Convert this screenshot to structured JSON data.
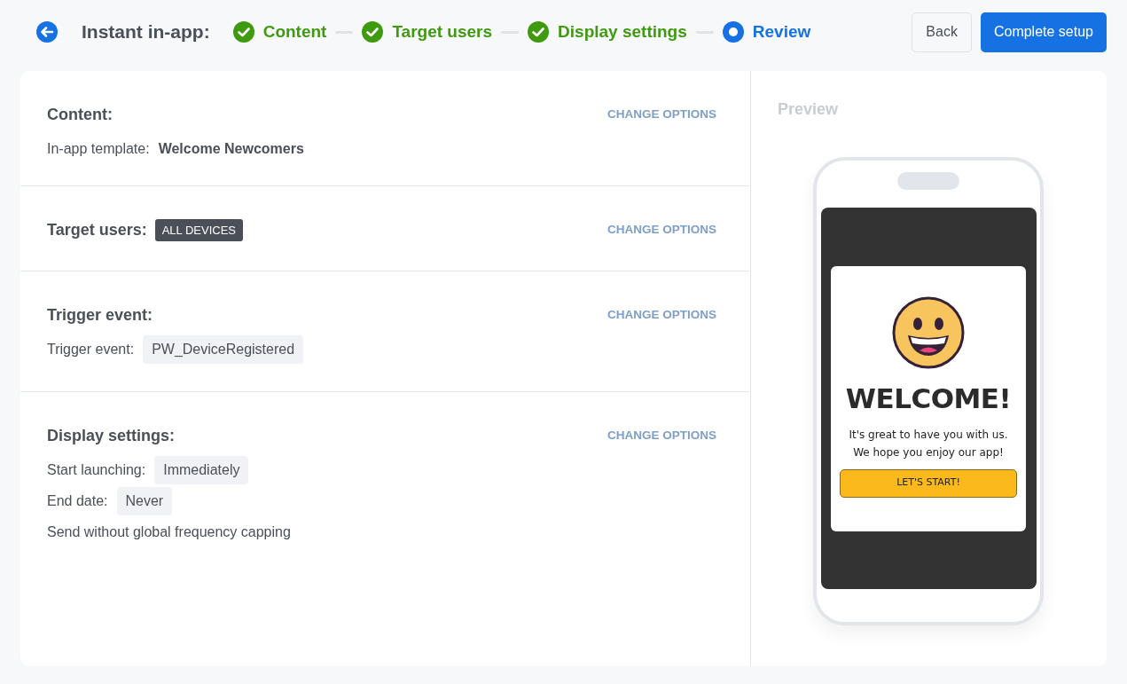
{
  "header": {
    "title": "Instant in-app:",
    "steps": [
      {
        "label": "Content",
        "done": true,
        "selected": false
      },
      {
        "label": "Target users",
        "done": true,
        "selected": false
      },
      {
        "label": "Display settings",
        "done": true,
        "selected": false
      },
      {
        "label": "Review",
        "done": false,
        "selected": true
      }
    ],
    "buttons": [
      {
        "label": "Back",
        "kind": "secondary"
      },
      {
        "label": "Complete setup",
        "kind": "primary"
      }
    ]
  },
  "sections": [
    {
      "title": "Content:",
      "action": "CHANGE OPTIONS",
      "rows": [
        {
          "kind": "bold",
          "label": "In-app template:",
          "value": "Welcome Newcomers"
        }
      ]
    },
    {
      "title": "Target users:",
      "badge": "ALL DEVICES",
      "action": "CHANGE OPTIONS"
    },
    {
      "title": "Trigger event:",
      "action": "CHANGE OPTIONS",
      "rows": [
        {
          "kind": "chip",
          "label": "Trigger event:",
          "value": "PW_DeviceRegistered"
        }
      ]
    },
    {
      "title": "Display settings:",
      "action": "CHANGE OPTIONS",
      "rows": [
        {
          "kind": "chip",
          "label": "Start launching:",
          "value": "Immediately"
        },
        {
          "kind": "chip",
          "label": "End date:",
          "value": "Never"
        },
        {
          "kind": "text",
          "text": "Send without global frequency capping"
        }
      ]
    }
  ],
  "preview": {
    "title": "Preview",
    "heading": "WELCOME!",
    "message": "It's great to have you with us. We hope you enjoy our app!",
    "button": "LET'S START!"
  }
}
